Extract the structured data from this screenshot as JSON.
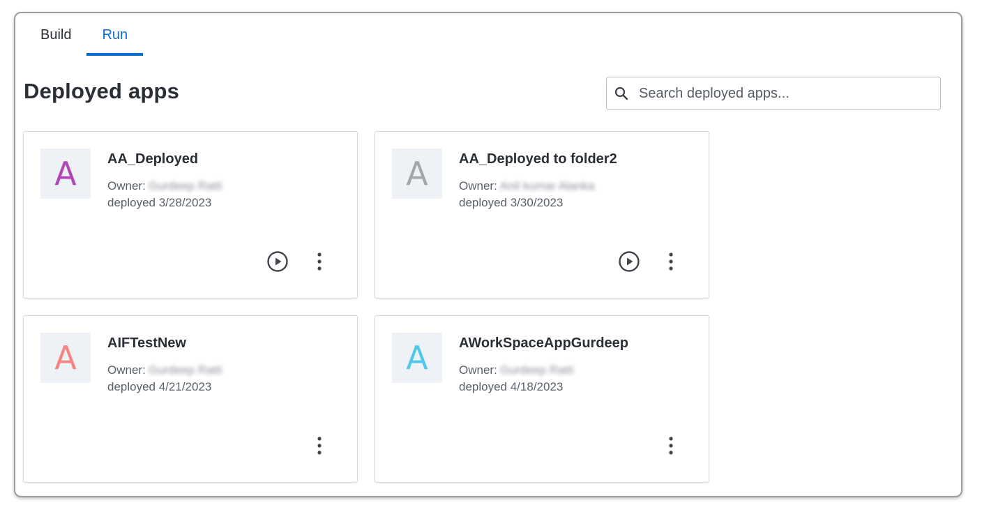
{
  "tabs": [
    {
      "label": "Build",
      "active": false
    },
    {
      "label": "Run",
      "active": true
    }
  ],
  "page": {
    "title": "Deployed apps"
  },
  "search": {
    "placeholder": "Search deployed apps...",
    "value": "",
    "icon": "search-icon"
  },
  "colors": {
    "accent": "#0a6ed1",
    "avatar_bg": "#eef1f6"
  },
  "apps": [
    {
      "initial": "A",
      "initial_color": "#b045b5",
      "name": "AA_Deployed",
      "owner_label": "Owner:",
      "owner": "Gurdeep Ratti",
      "deployed": "deployed 3/28/2023",
      "has_run": true
    },
    {
      "initial": "A",
      "initial_color": "#a3a6ab",
      "name": "AA_Deployed to folder2",
      "owner_label": "Owner:",
      "owner": "Anil kumar Alanka",
      "deployed": "deployed 3/30/2023",
      "has_run": true
    },
    {
      "initial": "A",
      "initial_color": "#f4847f",
      "name": "AIFTestNew",
      "owner_label": "Owner:",
      "owner": "Gurdeep Ratti",
      "deployed": "deployed 4/21/2023",
      "has_run": false
    },
    {
      "initial": "A",
      "initial_color": "#4fc8ea",
      "name": "AWorkSpaceAppGurdeep",
      "owner_label": "Owner:",
      "owner": "Gurdeep Ratti",
      "deployed": "deployed 4/18/2023",
      "has_run": false
    }
  ]
}
